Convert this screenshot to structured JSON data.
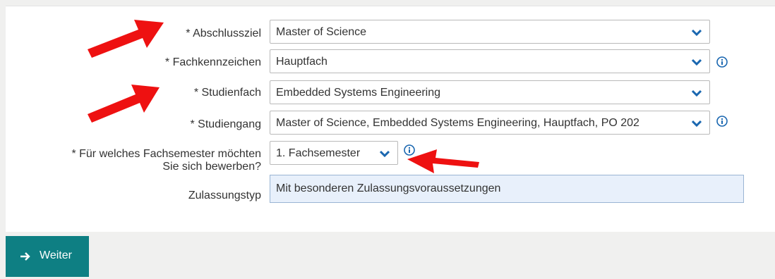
{
  "form": {
    "abschlussziel": {
      "label": "* Abschlussziel",
      "value": "Master of Science"
    },
    "fachkennzeichen": {
      "label": "* Fachkennzeichen",
      "value": "Hauptfach"
    },
    "studienfach": {
      "label": "* Studienfach",
      "value": "Embedded Systems Engineering"
    },
    "studiengang": {
      "label": "* Studiengang",
      "value": "Master of Science, Embedded Systems Engineering, Hauptfach, PO 202"
    },
    "fachsemester": {
      "label_line1": "* Für welches Fachsemester möchten",
      "label_line2": "Sie sich bewerben?",
      "value": "1. Fachsemester"
    },
    "zulassungstyp": {
      "label": "Zulassungstyp",
      "value": "Mit besonderen Zulassungsvoraussetzungen"
    }
  },
  "actions": {
    "weiter_label": "Weiter"
  },
  "icons": {
    "chevron": "chevron-down-icon",
    "info": "info-icon",
    "arrow": "arrow-right-icon",
    "annotation": "red-arrow-annotation"
  },
  "colors": {
    "accent": "#0e7f83",
    "link_blue": "#1a67b0",
    "annotation_red": "#ee1111",
    "readonly_bg": "#e8f0fb"
  }
}
